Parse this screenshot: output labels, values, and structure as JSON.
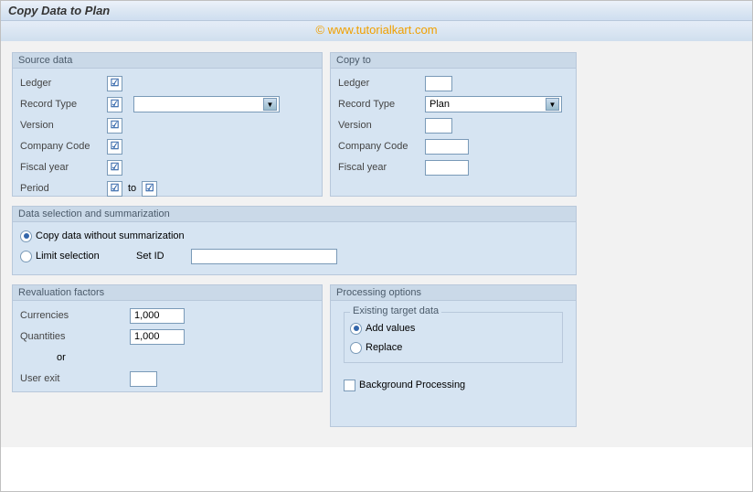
{
  "window": {
    "title": "Copy Data to Plan",
    "watermark": "© www.tutorialkart.com"
  },
  "sourceData": {
    "title": "Source data",
    "ledgerLabel": "Ledger",
    "recordTypeLabel": "Record Type",
    "versionLabel": "Version",
    "companyCodeLabel": "Company Code",
    "fiscalYearLabel": "Fiscal year",
    "periodLabel": "Period",
    "periodTo": "to",
    "checkMark": "☑"
  },
  "copyTo": {
    "title": "Copy to",
    "ledgerLabel": "Ledger",
    "recordTypeLabel": "Record Type",
    "recordTypeValue": "Plan",
    "versionLabel": "Version",
    "companyCodeLabel": "Company Code",
    "fiscalYearLabel": "Fiscal year"
  },
  "dataSelection": {
    "title": "Data selection and summarization",
    "opt1": "Copy data without summarization",
    "opt2": "Limit selection",
    "setIdLabel": "Set ID"
  },
  "revaluation": {
    "title": "Revaluation factors",
    "currenciesLabel": "Currencies",
    "currenciesValue": "1,000",
    "quantitiesLabel": "Quantities",
    "quantitiesValue": "1,000",
    "orLabel": "or",
    "userExitLabel": "User exit"
  },
  "processing": {
    "title": "Processing options",
    "groupTitle": "Existing target data",
    "addValues": "Add values",
    "replace": "Replace",
    "background": "Background Processing"
  }
}
